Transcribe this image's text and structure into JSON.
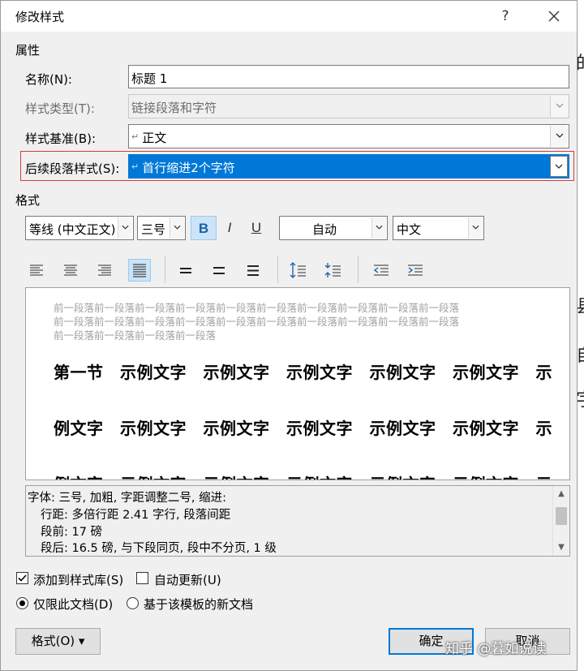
{
  "dialog": {
    "title": "修改样式",
    "help_label": "?"
  },
  "properties": {
    "section_label": "属性",
    "name_label": "名称(N):",
    "name_value": "标题 1",
    "type_label": "样式类型(T):",
    "type_value": "链接段落和字符",
    "base_label": "样式基准(B):",
    "base_value": "正文",
    "next_label": "后续段落样式(S):",
    "next_value": "首行缩进2个字符",
    "para_mark": "↵"
  },
  "format": {
    "section_label": "格式",
    "font_value": "等线 (中文正文)",
    "size_value": "三号",
    "bold": "B",
    "italic": "I",
    "underline": "U",
    "color_value": "自动",
    "script_value": "中文"
  },
  "preview": {
    "prev_para_lines": [
      "前一段落前一段落前一段落前一段落前一段落前一段落前一段落前一段落前一段落前一段落",
      "前一段落前一段落前一段落前一段落前一段落前一段落前一段落前一段落前一段落前一段落",
      "前一段落前一段落前一段落前一段落"
    ],
    "sample_lines": [
      "第一节　示例文字　示例文字　示例文字　示例文字　示例文字　示",
      "例文字　示例文字　示例文字　示例文字　示例文字　示例文字　示",
      "例文字　示例文字　示例文字　示例文字　示例文字　示例文字　示"
    ]
  },
  "description": {
    "lines": [
      "字体: 三号, 加粗, 字距调整二号, 缩进:",
      "行距: 多倍行距 2.41 字行, 段落间距",
      "段前: 17 磅",
      "段后: 16.5 磅, 与下段同页, 段中不分页, 1 级"
    ]
  },
  "options": {
    "add_to_gallery_label": "添加到样式库(S)",
    "add_to_gallery_checked": true,
    "auto_update_label": "自动更新(U)",
    "auto_update_checked": false,
    "this_doc_label": "仅限此文档(D)",
    "new_docs_label": "基于该模板的新文档",
    "selected_scope": "this_doc"
  },
  "buttons": {
    "format_label": "格式(O) ▾",
    "ok_label": "确定",
    "cancel_label": "取消"
  },
  "watermark": "知乎 @暮如说读",
  "colors": {
    "accent": "#0078d7",
    "highlight_box": "#d23c3c"
  }
}
